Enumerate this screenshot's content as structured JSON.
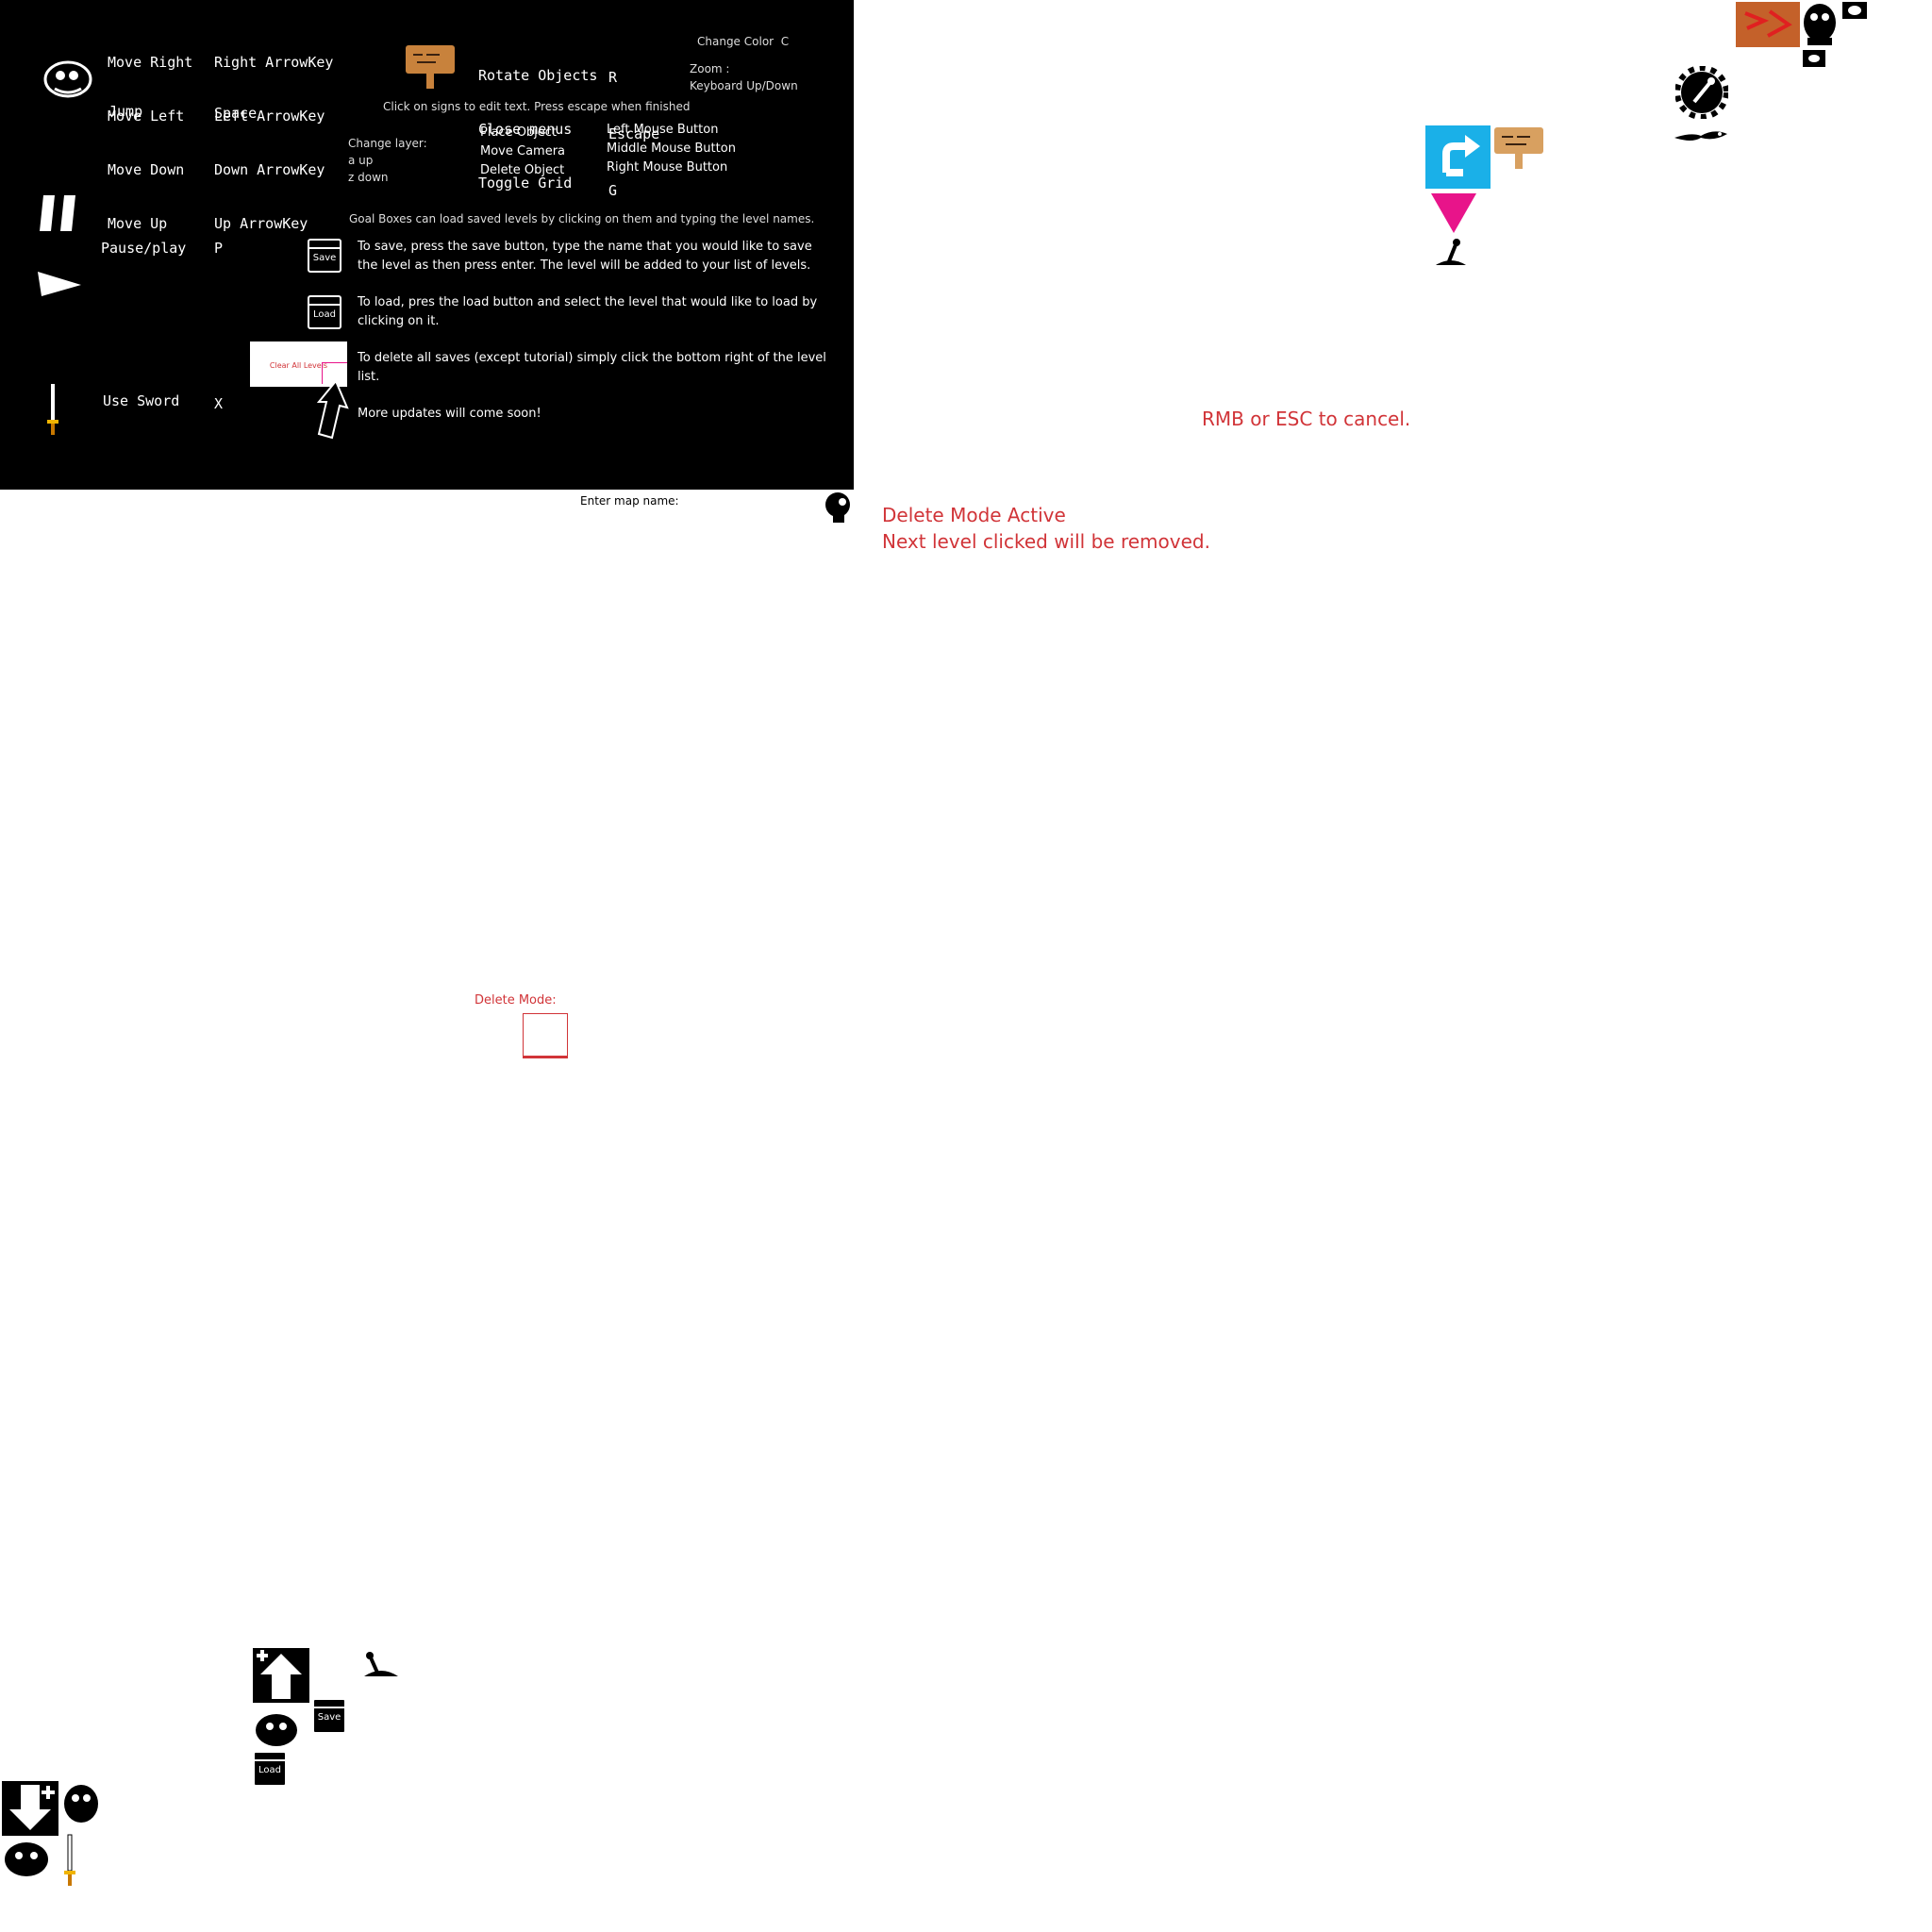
{
  "controls": {
    "move_labels": [
      "Move Right",
      "Move Left",
      "Move Down",
      "Move Up"
    ],
    "move_keys": [
      "Right ArrowKey",
      "Left ArrowKey",
      "Down ArrowKey",
      "Up ArrowKey"
    ],
    "jump_label": "Jump",
    "jump_key": "Space",
    "pause_label": "Pause/play",
    "pause_key": "P",
    "sword_label": "Use Sword",
    "sword_key": "X"
  },
  "editor": {
    "actions": [
      "Rotate Objects",
      "Close menus",
      "Toggle Grid"
    ],
    "action_keys": [
      "R",
      "Escape",
      "G"
    ],
    "change_color": "Change Color",
    "change_color_key": "C",
    "zoom_label": "Zoom :",
    "zoom_keys": "Keyboard Up/Down",
    "sign_hint": "Click on signs to edit text. Press escape when finished",
    "layer_title": "Change layer:",
    "layer_up": "a up",
    "layer_down": "z down",
    "mouse_actions": [
      "Place Object",
      "Move Camera",
      "Delete Object"
    ],
    "mouse_buttons": [
      "Left Mouse Button",
      "Middle Mouse Button",
      "Right Mouse Button"
    ],
    "goal_hint": "Goal Boxes can load saved levels by clicking on them and typing the level names."
  },
  "instructions": {
    "save_text": "To save, press the save button, type the name that you would like to save the level as then press enter. The level will be added to your list of levels.",
    "load_text": "To load, pres the load button and select the level that would like to load by clicking on it.",
    "delete_text": "To delete all saves (except tutorial) simply click the bottom right of the level list.",
    "updates_text": "More updates will come soon!",
    "clear_all_label": "Clear All Levels",
    "save_icon_text": "Save",
    "load_icon_text": "Load"
  },
  "map_prompt": "Enter map name:",
  "cancel_hint": "RMB or ESC to cancel.",
  "delete_mode_active": "Delete Mode Active",
  "delete_mode_next": "Next level clicked will be removed.",
  "delete_mode_label": "Delete Mode:",
  "palette_icons": [
    "wood-block-icon",
    "ghost-icon",
    "eye-icon",
    "gear-wrench-icon",
    "lizard-icon",
    "blue-redo-icon",
    "sign-icon",
    "pink-triangle-icon",
    "lever-icon"
  ],
  "colors": {
    "panel": "#000000",
    "accent_red": "#d13438",
    "cyan": "#1ab0e8",
    "pink": "#e8148a",
    "wood": "#c8823c"
  }
}
